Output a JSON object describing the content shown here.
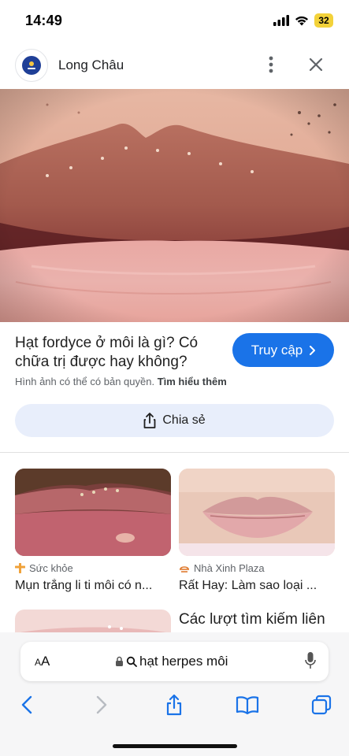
{
  "status_bar": {
    "time": "14:49",
    "battery": "32"
  },
  "header": {
    "site_name": "Long Châu"
  },
  "result": {
    "title": "Hạt fordyce ở môi là gì? Có chữa trị được hay không?",
    "visit_label": "Truy cập",
    "copyright_text": "Hình ảnh có thể có bản quyền.",
    "learn_more": "Tìm hiểu thêm",
    "share_label": "Chia sẻ"
  },
  "related": [
    {
      "source": "Sức khỏe",
      "title": "Mụn trắng li ti môi có n...",
      "source_icon": "plus-cross-icon",
      "source_color": "#f0a23a"
    },
    {
      "source": "Nhà Xinh Plaza",
      "title": "Rất Hay: Làm sao loại ...",
      "source_icon": "scale-icon",
      "source_color": "#e07a2e"
    }
  ],
  "related_searches_heading": "Các lượt tìm kiếm liên",
  "browser": {
    "reader_label_small": "A",
    "reader_label_large": "A",
    "url": "hạt herpes môi"
  },
  "colors": {
    "accent": "#1a73e8",
    "share_bg": "#e8eefb",
    "battery": "#f3d23a"
  }
}
